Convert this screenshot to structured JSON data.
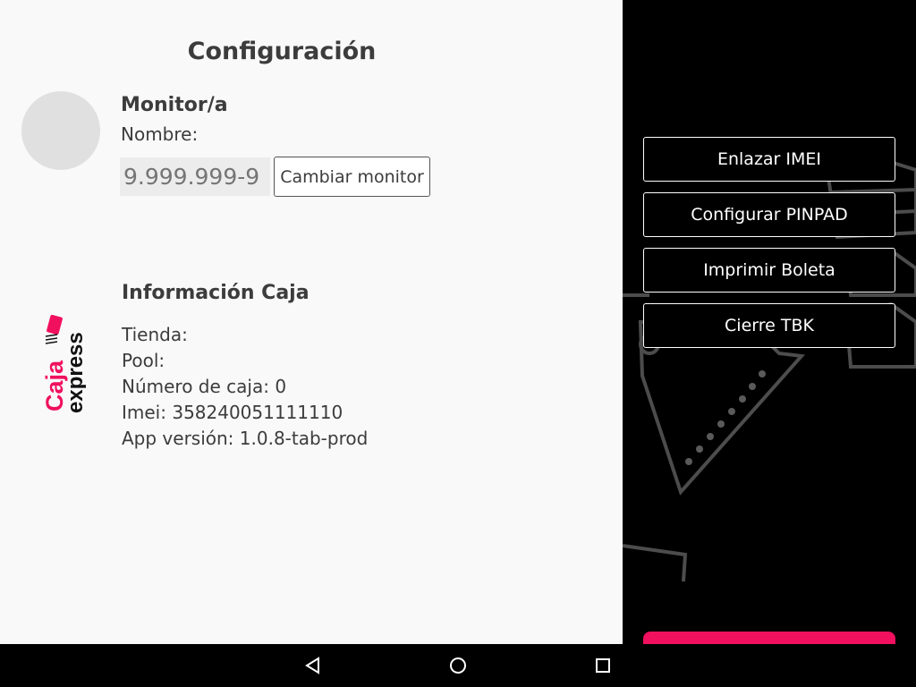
{
  "page": {
    "title": "Configuración"
  },
  "monitor": {
    "heading": "Monitor/a",
    "name_label": "Nombre:",
    "rut_placeholder": "9.999.999-9",
    "change_button": "Cambiar monitor"
  },
  "caja_info": {
    "heading": "Información Caja",
    "tienda": "Tienda:",
    "pool": "Pool:",
    "numero_caja": "Número de caja: 0",
    "imei": "Imei: 358240051111110",
    "app_version": "App versión: 1.0.8-tab-prod"
  },
  "logo": {
    "top_word": "Caja",
    "bottom_word": "express"
  },
  "actions": {
    "enlazar_imei": "Enlazar IMEI",
    "configurar_pinpad": "Configurar PINPAD",
    "imprimir_boleta": "Imprimir Boleta",
    "cierre_tbk": "Cierre TBK"
  },
  "colors": {
    "brand_pink": "#f0105e",
    "panel_bg": "#f9f9f9",
    "text": "#3c3c3c"
  },
  "nav_icons": [
    "back-icon",
    "home-icon",
    "recents-icon"
  ]
}
